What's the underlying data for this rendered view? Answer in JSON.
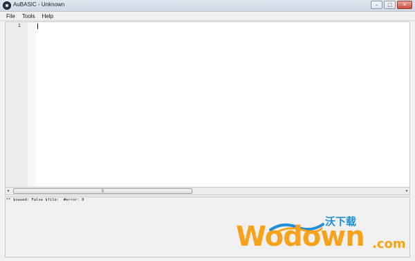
{
  "window": {
    "title": "AuBASIC - Unknown",
    "buttons": {
      "minimize": "–",
      "maximize": "□",
      "close": "✕"
    }
  },
  "menu": {
    "items": [
      {
        "label": "File"
      },
      {
        "label": "Tools"
      },
      {
        "label": "Help"
      }
    ]
  },
  "editor": {
    "line_numbers": [
      "1"
    ],
    "content": ""
  },
  "scrollbar": {
    "left_arrow": "◂",
    "right_arrow": "▸",
    "grip": "|||"
  },
  "status": {
    "text": "** $saved: False $file:  #error: 0"
  },
  "watermark": {
    "brand": "Wodown",
    "suffix": ".com",
    "chinese": "沃下载"
  },
  "colors": {
    "watermark_orange": "#f7a21b",
    "watermark_blue": "#1e8fd6",
    "close_red": "#c94f3b"
  }
}
